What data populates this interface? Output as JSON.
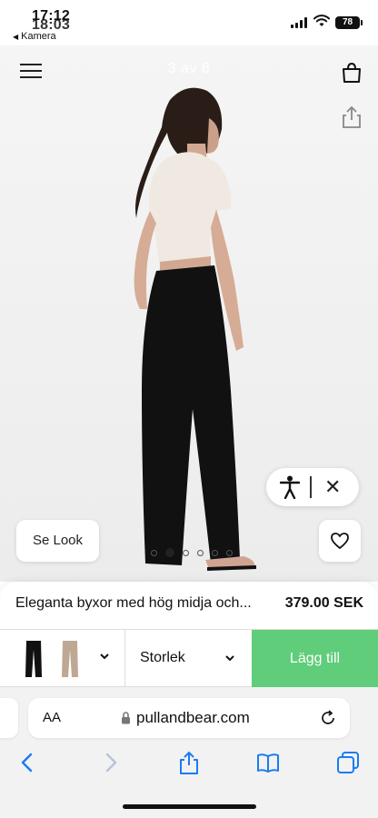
{
  "status_bar": {
    "time": "17:12",
    "time_ghost": "18:03",
    "back_label": "Kamera",
    "battery": "78"
  },
  "header": {
    "image_counter": "3 av 8"
  },
  "look_button": "Se Look",
  "gallery": {
    "total_dots": 6,
    "active_index": 1
  },
  "product": {
    "name": "Eleganta byxor med hög midja och...",
    "price": "379.00 SEK"
  },
  "options": {
    "size_label": "Storlek",
    "add_label": "Lägg till",
    "color_swatches": [
      "black",
      "beige"
    ]
  },
  "browser": {
    "text_size_label": "AA",
    "url": "pullandbear.com"
  },
  "colors": {
    "accent_green": "#5fcd7a",
    "background": "#f3f3f3"
  }
}
